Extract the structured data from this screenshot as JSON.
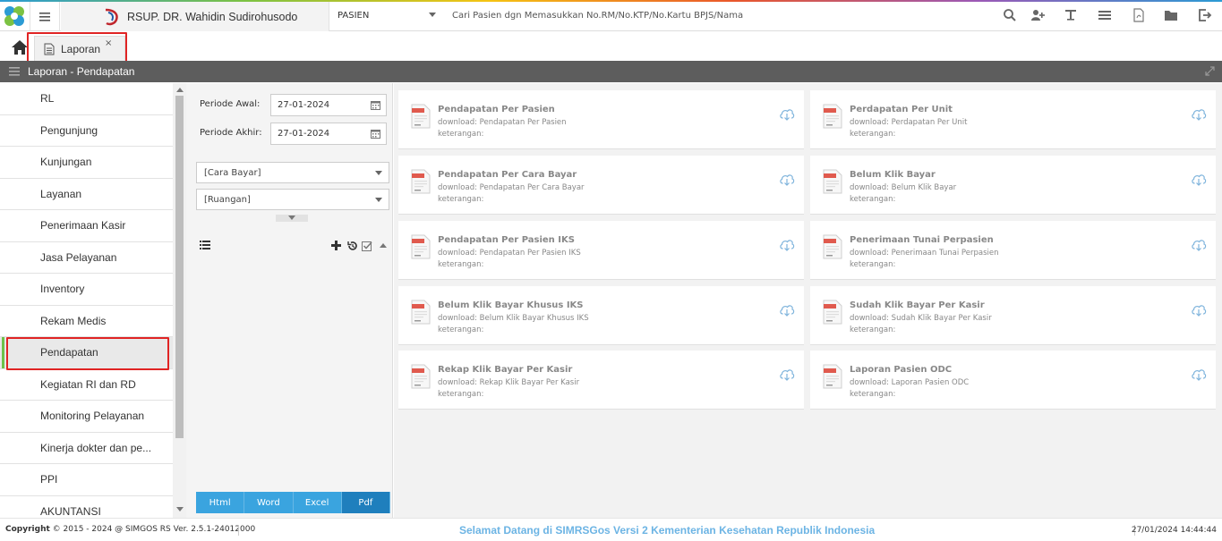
{
  "header": {
    "hospital_name": "RSUP. DR. Wahidin Sudirohusodo",
    "patient_selector": "PASIEN",
    "search_placeholder": "Cari Pasien dgn Memasukkan No.RM/No.KTP/No.Kartu BPJS/Nama",
    "icons": [
      "search-icon",
      "add-user-icon",
      "text-icon",
      "list-icon",
      "pdf-icon",
      "folder-icon",
      "logout-icon"
    ]
  },
  "tabs": [
    {
      "label": "Laporan",
      "close": "×"
    }
  ],
  "section_title": "Laporan - Pendapatan",
  "sidebar": {
    "items": [
      {
        "label": "RL"
      },
      {
        "label": "Pengunjung"
      },
      {
        "label": "Kunjungan"
      },
      {
        "label": "Layanan"
      },
      {
        "label": "Penerimaan Kasir"
      },
      {
        "label": "Jasa Pelayanan"
      },
      {
        "label": "Inventory"
      },
      {
        "label": "Rekam Medis"
      },
      {
        "label": "Pendapatan"
      },
      {
        "label": "Kegiatan RI dan RD"
      },
      {
        "label": "Monitoring Pelayanan"
      },
      {
        "label": "Kinerja dokter dan pe..."
      },
      {
        "label": "PPI"
      },
      {
        "label": "AKUNTANSI"
      }
    ],
    "active_index": 8
  },
  "filter": {
    "periode_awal_label": "Periode Awal:",
    "periode_awal_value": "27-01-2024",
    "periode_akhir_label": "Periode Akhir:",
    "periode_akhir_value": "27-01-2024",
    "cara_bayar": "[Cara Bayar]",
    "ruangan": "[Ruangan]",
    "formats": [
      "Html",
      "Word",
      "Excel",
      "Pdf"
    ],
    "selected_format": "Pdf"
  },
  "reports": [
    {
      "title": "Pendapatan Per Pasien",
      "download": "download: Pendapatan Per Pasien",
      "keterangan": "keterangan:"
    },
    {
      "title": "Perdapatan Per Unit",
      "download": "download: Perdapatan Per Unit",
      "keterangan": "keterangan:"
    },
    {
      "title": "Pendapatan Per Cara Bayar",
      "download": "download: Pendapatan Per Cara Bayar",
      "keterangan": "keterangan:"
    },
    {
      "title": "Belum Klik Bayar",
      "download": "download: Belum Klik Bayar",
      "keterangan": "keterangan:"
    },
    {
      "title": "Pendapatan Per Pasien IKS",
      "download": "download: Pendapatan Per Pasien IKS",
      "keterangan": "keterangan:"
    },
    {
      "title": "Penerimaan Tunai Perpasien",
      "download": "download: Penerimaan Tunai Perpasien",
      "keterangan": "keterangan:"
    },
    {
      "title": "Belum Klik Bayar Khusus IKS",
      "download": "download: Belum Klik Bayar Khusus IKS",
      "keterangan": "keterangan:"
    },
    {
      "title": "Sudah Klik Bayar Per Kasir",
      "download": "download: Sudah Klik Bayar Per Kasir",
      "keterangan": "keterangan:"
    },
    {
      "title": "Rekap Klik Bayar Per Kasir",
      "download": "download: Rekap Klik Bayar Per Kasir",
      "keterangan": "keterangan:"
    },
    {
      "title": "Laporan Pasien ODC",
      "download": "download: Laporan Pasien ODC",
      "keterangan": "keterangan:"
    }
  ],
  "footer": {
    "copyright_bold": "Copyright",
    "copyright_rest": "2015 - 2024 @ SIMGOS RS Ver. 2.5.1-24012000",
    "welcome": "Selamat Datang di SIMRSGos Versi 2 Kementerian Kesehatan Republik Indonesia",
    "datetime": "27/01/2024 14:44:44"
  },
  "colors": {
    "accent": "#3aa4df",
    "active_marker": "#6ec24a",
    "highlight": "#e02424",
    "bar": "#5d5d5d"
  }
}
